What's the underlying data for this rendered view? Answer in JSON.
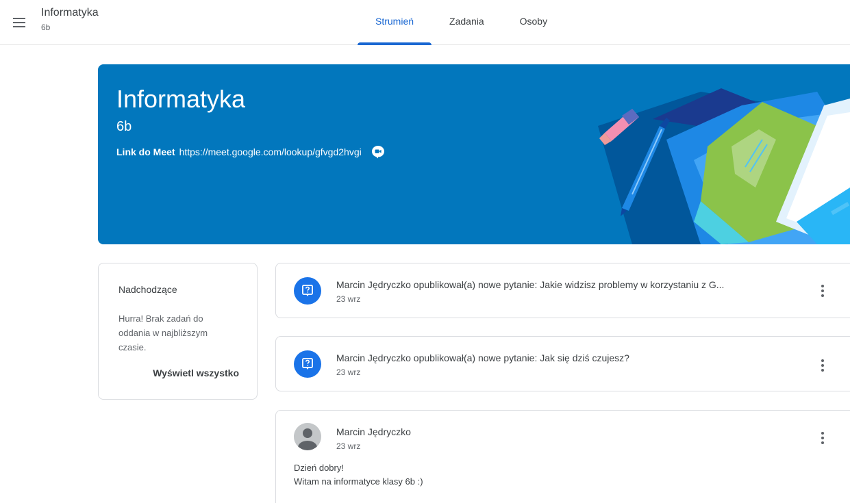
{
  "header": {
    "class_name": "Informatyka",
    "class_section": "6b",
    "tabs": [
      {
        "label": "Strumień",
        "active": true
      },
      {
        "label": "Zadania",
        "active": false
      },
      {
        "label": "Osoby",
        "active": false
      }
    ]
  },
  "banner": {
    "title": "Informatyka",
    "section": "6b",
    "meet_label": "Link do Meet",
    "meet_url": "https://meet.google.com/lookup/gfvgd2hvgi",
    "background_color": "#0277bd"
  },
  "upcoming": {
    "title": "Nadchodzące",
    "message": "Hurra! Brak zadań do oddania w najbliższym czasie.",
    "view_all_label": "Wyświetl wszystko"
  },
  "stream": {
    "posts": [
      {
        "type": "question",
        "icon": "question-assignment-icon",
        "title": "Marcin Jędryczko opublikował(a) nowe pytanie: Jakie widzisz problemy w korzystaniu z G...",
        "date": "23 wrz"
      },
      {
        "type": "question",
        "icon": "question-assignment-icon",
        "title": "Marcin Jędryczko opublikował(a) nowe pytanie: Jak się dziś czujesz?",
        "date": "23 wrz"
      },
      {
        "type": "announcement",
        "icon": "avatar-icon",
        "author": "Marcin Jędryczko",
        "date": "23 wrz",
        "body_line1": "Dzień dobry!",
        "body_line2": "Witam na informatyce klasy 6b :)"
      }
    ]
  },
  "colors": {
    "accent": "#1967d2",
    "question_icon_bg": "#1a73e8"
  }
}
